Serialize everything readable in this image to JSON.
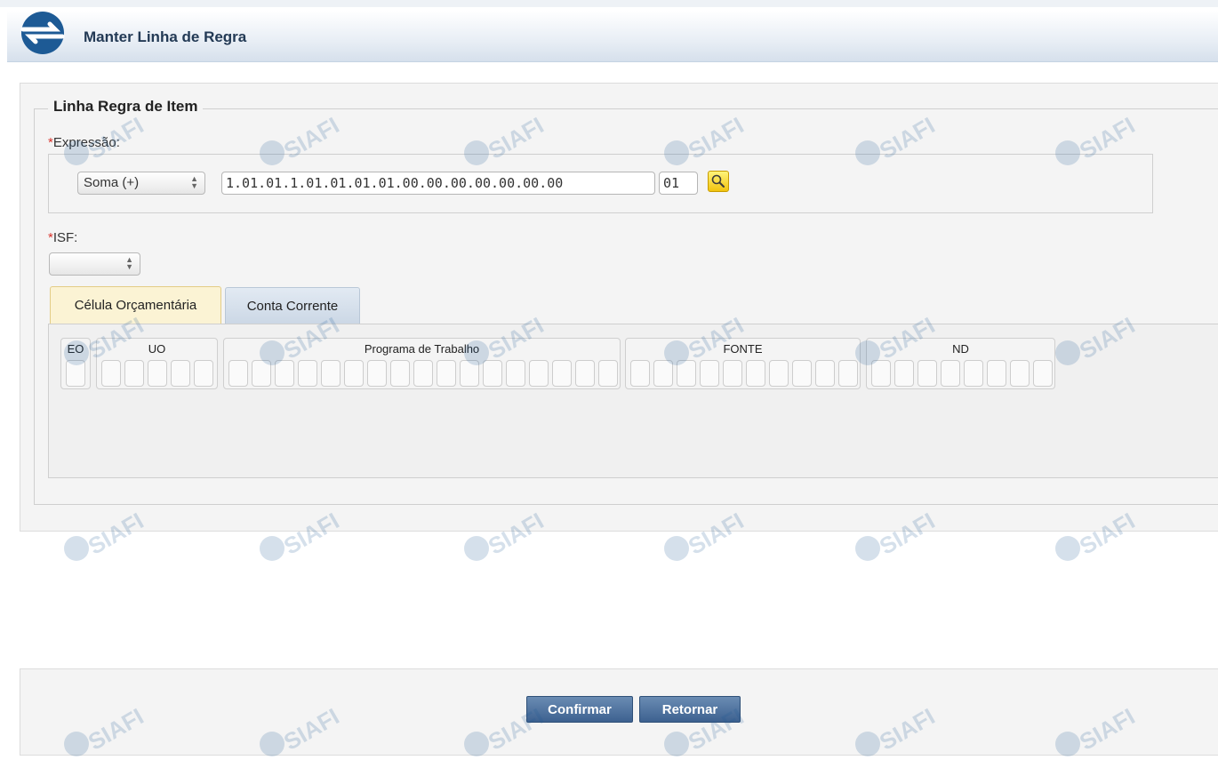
{
  "window": {
    "title": "Manter Linha de Regra"
  },
  "fieldset": {
    "legend": "Linha Regra de Item"
  },
  "expressao": {
    "required_mark": "*",
    "label": "Expressão:",
    "operation_value": "Soma (+)",
    "code_value": "1.01.01.1.01.01.01.01.00.00.00.00.00.00.00",
    "suffix_value": "01"
  },
  "isf": {
    "required_mark": "*",
    "label": "ISF:",
    "value": ""
  },
  "tabs": [
    {
      "label": "Célula Orçamentária",
      "active": true
    },
    {
      "label": "Conta Corrente",
      "active": false
    }
  ],
  "cell_groups": {
    "eo": "EO",
    "uo": "UO",
    "programa": "Programa de Trabalho",
    "fonte": "FONTE",
    "nd": "ND"
  },
  "watermark_text": "SIAFI",
  "buttons": {
    "confirm": "Confirmar",
    "return": "Retornar"
  },
  "colors": {
    "primary_button": "#4a6f9c",
    "active_tab": "#fbf3d4",
    "required": "#d9332c",
    "search_button": "#f1c40f"
  }
}
